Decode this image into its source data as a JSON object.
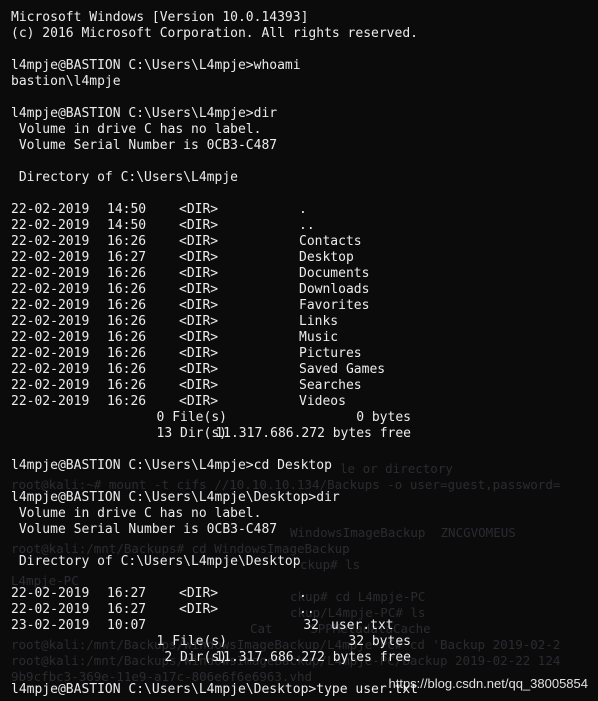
{
  "terminal": {
    "banner": [
      "Microsoft Windows [Version 10.0.14393]",
      "(c) 2016 Microsoft Corporation. All rights reserved."
    ],
    "whoami": {
      "prompt": "l4mpje@BASTION C:\\Users\\L4mpje>whoami",
      "output": "bastion\\l4mpje"
    },
    "dir_users": {
      "prompt": "l4mpje@BASTION C:\\Users\\L4mpje>dir",
      "volume_line1": " Volume in drive C has no label.",
      "volume_line2": " Volume Serial Number is 0CB3-C487",
      "directory_line": " Directory of C:\\Users\\L4mpje",
      "entries": [
        {
          "date": "22-02-2019",
          "time": "14:50",
          "type": "<DIR>",
          "size": "",
          "name": "."
        },
        {
          "date": "22-02-2019",
          "time": "14:50",
          "type": "<DIR>",
          "size": "",
          "name": ".."
        },
        {
          "date": "22-02-2019",
          "time": "16:26",
          "type": "<DIR>",
          "size": "",
          "name": "Contacts"
        },
        {
          "date": "22-02-2019",
          "time": "16:27",
          "type": "<DIR>",
          "size": "",
          "name": "Desktop"
        },
        {
          "date": "22-02-2019",
          "time": "16:26",
          "type": "<DIR>",
          "size": "",
          "name": "Documents"
        },
        {
          "date": "22-02-2019",
          "time": "16:26",
          "type": "<DIR>",
          "size": "",
          "name": "Downloads"
        },
        {
          "date": "22-02-2019",
          "time": "16:26",
          "type": "<DIR>",
          "size": "",
          "name": "Favorites"
        },
        {
          "date": "22-02-2019",
          "time": "16:26",
          "type": "<DIR>",
          "size": "",
          "name": "Links"
        },
        {
          "date": "22-02-2019",
          "time": "16:26",
          "type": "<DIR>",
          "size": "",
          "name": "Music"
        },
        {
          "date": "22-02-2019",
          "time": "16:26",
          "type": "<DIR>",
          "size": "",
          "name": "Pictures"
        },
        {
          "date": "22-02-2019",
          "time": "16:26",
          "type": "<DIR>",
          "size": "",
          "name": "Saved Games"
        },
        {
          "date": "22-02-2019",
          "time": "16:26",
          "type": "<DIR>",
          "size": "",
          "name": "Searches"
        },
        {
          "date": "22-02-2019",
          "time": "16:26",
          "type": "<DIR>",
          "size": "",
          "name": "Videos"
        }
      ],
      "summary": [
        {
          "left": "0 File(s)",
          "right": "0 bytes"
        },
        {
          "left": "13 Dir(s)",
          "right": "11.317.686.272 bytes free"
        }
      ]
    },
    "cd_desktop": {
      "prompt": "l4mpje@BASTION C:\\Users\\L4mpje>cd Desktop"
    },
    "dir_desktop": {
      "prompt": "l4mpje@BASTION C:\\Users\\L4mpje\\Desktop>dir",
      "volume_line1": " Volume in drive C has no label.",
      "volume_line2": " Volume Serial Number is 0CB3-C487",
      "directory_line": " Directory of C:\\Users\\L4mpje\\Desktop",
      "entries": [
        {
          "date": "22-02-2019",
          "time": "16:27",
          "type": "<DIR>",
          "size": "",
          "name": "."
        },
        {
          "date": "22-02-2019",
          "time": "16:27",
          "type": "<DIR>",
          "size": "",
          "name": ".."
        },
        {
          "date": "23-02-2019",
          "time": "10:07",
          "type": "",
          "size": "32",
          "name": "user.txt"
        }
      ],
      "summary": [
        {
          "left": "1 File(s)",
          "right": "32 bytes"
        },
        {
          "left": "2 Dir(s)",
          "right": "11.317.686.272 bytes free"
        }
      ]
    },
    "type_user": {
      "prompt": "l4mpje@BASTION C:\\Users\\L4mpje\\Desktop>type user.txt"
    }
  },
  "background_ghost_text": [
    "le or directory",
    "root@kali:~# mount -t cifs //10.10.10.134/Backups -o user=guest,password=",
    "WindowsImageBackup  ZNCGVOMEUS",
    "root@kali:/mnt/Backups# cd WindowsImageBackup",
    "ckup# ls",
    "L4mpje-PC",
    "ckup# cd L4mpje-PC",
    "ckup/L4mpje-PC# ls",
    "Cat     SPPMetadataCache",
    "root@kali:/mnt/Backups/WindowsImageBackup/L4mpje-PC# cd 'Backup 2019-02-2",
    "root@kali:/mnt/Backups/WindowsImageBackup/L4mpje-PC/Backup 2019-02-22 124",
    "9b9cfbc3-369e-11e9-a17c-806e6f6e6963.vhd"
  ],
  "watermark": "https://blog.csdn.net/qq_38005854",
  "colors": {
    "background": "#0b0b0b",
    "foreground": "#ececec"
  }
}
